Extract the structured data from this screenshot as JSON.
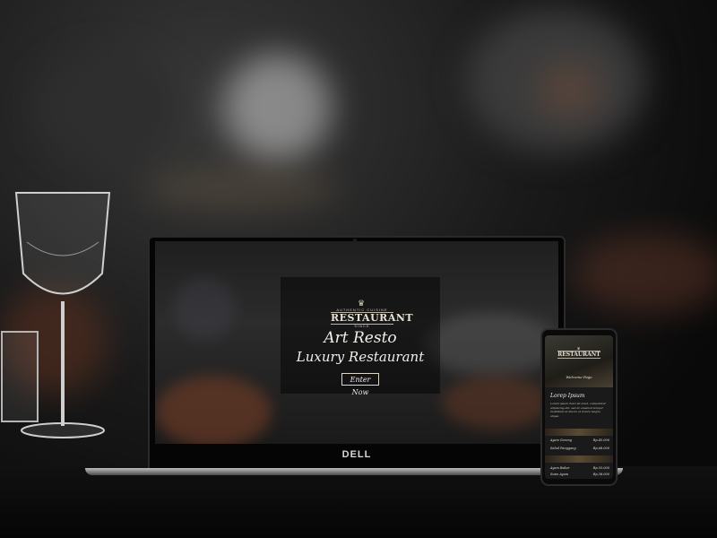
{
  "laptop": {
    "brand": "DELL",
    "site": {
      "logo_top": "♛",
      "logo_caption": "AUTHENTIC CUISINE",
      "logo_word": "RESTAURANT",
      "logo_since": "SINCE",
      "title_line1": "Art Resto",
      "title_line2": "Luxury Restaurant",
      "cta_label": "Enter Now"
    }
  },
  "phone": {
    "logo_word": "RESTAURANT",
    "logo_top": "♛",
    "subtitle": "Welcome Page",
    "heading": "Lorep Ipsum",
    "paragraph": "Lorem ipsum dolor sit amet, consectetur adipiscing elit, sed do eiusmod tempor incididunt ut labore et dolore magna aliqua.",
    "menu": [
      {
        "name": "Ayam Goreng",
        "price": "Rp.45.000"
      },
      {
        "name": "Sahal Panggang",
        "price": "Rp.68.000"
      },
      {
        "name": "Ayam Bakar",
        "price": "Rp.55.000"
      },
      {
        "name": "Sosis Ayam",
        "price": "Rp.38.000"
      }
    ]
  }
}
